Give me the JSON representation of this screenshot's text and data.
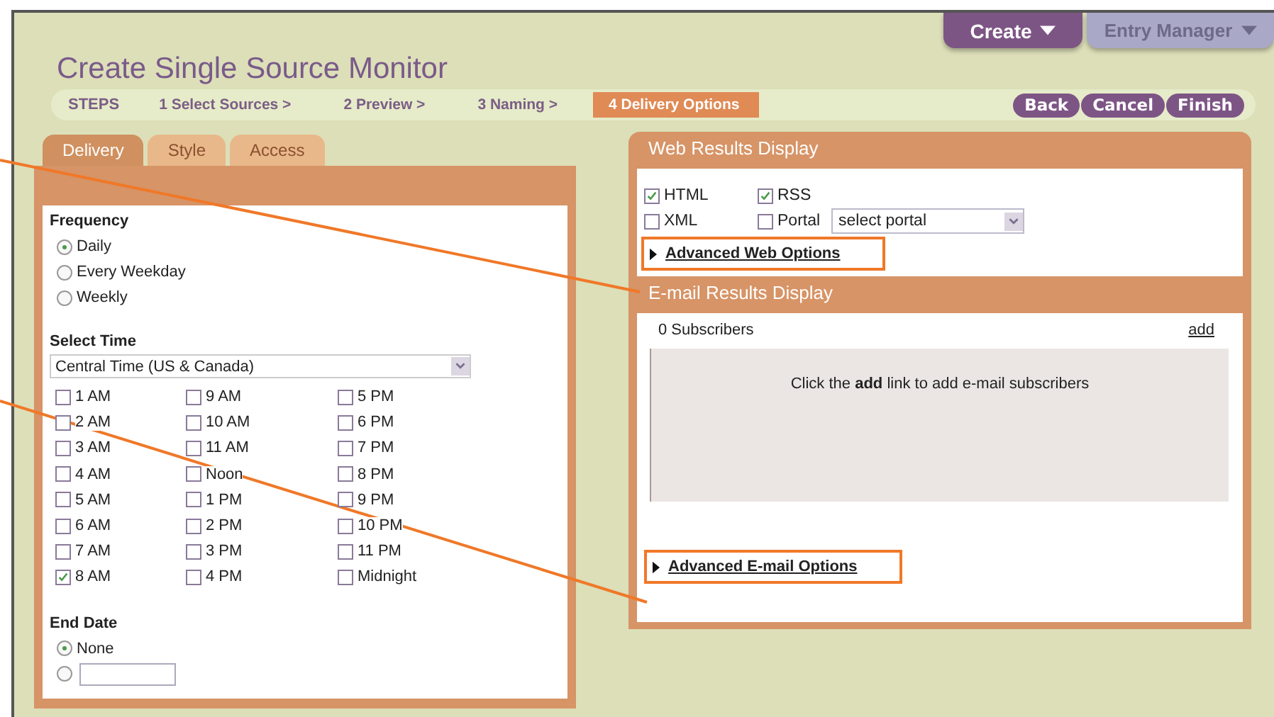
{
  "menus": [
    {
      "label": "Create"
    },
    {
      "label": "Entry Manager"
    }
  ],
  "title": "Create Single Source Monitor",
  "steps": {
    "label": "STEPS",
    "items": [
      {
        "label": "1 Select Sources >",
        "selected": false
      },
      {
        "label": "2 Preview >",
        "selected": false
      },
      {
        "label": "3 Naming >",
        "selected": false
      },
      {
        "label": "4 Delivery Options",
        "selected": true
      }
    ]
  },
  "actions": [
    "Back",
    "Cancel",
    "Finish"
  ],
  "tabs": [
    {
      "label": "Delivery",
      "selected": true
    },
    {
      "label": "Style",
      "selected": false
    },
    {
      "label": "Access",
      "selected": false
    }
  ],
  "frequency": {
    "label": "Frequency",
    "options": [
      {
        "label": "Daily",
        "selected": true
      },
      {
        "label": "Every Weekday",
        "selected": false
      },
      {
        "label": "Weekly",
        "selected": false
      }
    ]
  },
  "select_time": {
    "label": "Select Time",
    "timezone": "Central Time (US & Canada)",
    "times": [
      {
        "label": "1 AM",
        "checked": false
      },
      {
        "label": "2 AM",
        "checked": false
      },
      {
        "label": "3 AM",
        "checked": false
      },
      {
        "label": "4 AM",
        "checked": false
      },
      {
        "label": "5 AM",
        "checked": false
      },
      {
        "label": "6 AM",
        "checked": false
      },
      {
        "label": "7 AM",
        "checked": false
      },
      {
        "label": "8 AM",
        "checked": true
      },
      {
        "label": "9 AM",
        "checked": false
      },
      {
        "label": "10 AM",
        "checked": false
      },
      {
        "label": "11 AM",
        "checked": false
      },
      {
        "label": "Noon",
        "checked": false
      },
      {
        "label": "1 PM",
        "checked": false
      },
      {
        "label": "2 PM",
        "checked": false
      },
      {
        "label": "3 PM",
        "checked": false
      },
      {
        "label": "4 PM",
        "checked": false
      },
      {
        "label": "5 PM",
        "checked": false
      },
      {
        "label": "6 PM",
        "checked": false
      },
      {
        "label": "7 PM",
        "checked": false
      },
      {
        "label": "8 PM",
        "checked": false
      },
      {
        "label": "9 PM",
        "checked": false
      },
      {
        "label": "10 PM",
        "checked": false
      },
      {
        "label": "11 PM",
        "checked": false
      },
      {
        "label": "Midnight",
        "checked": false
      }
    ]
  },
  "end_date": {
    "label": "End Date",
    "options": [
      {
        "kind": "text",
        "label": "None",
        "selected": true
      },
      {
        "kind": "date",
        "selected": false
      }
    ]
  },
  "web_results": {
    "title": "Web Results Display",
    "formats": [
      {
        "label": "HTML",
        "checked": true
      },
      {
        "label": "RSS",
        "checked": true
      },
      {
        "label": "XML",
        "checked": false
      },
      {
        "label": "Portal",
        "checked": false
      }
    ],
    "portal_select": "select portal",
    "advanced": "Advanced Web Options"
  },
  "email_results": {
    "title": "E-mail Results Display",
    "subscribers": "0 Subscribers",
    "add": "add",
    "empty_message": "Click the **add** link to add e-mail subscribers",
    "advanced": "Advanced E-mail Options"
  }
}
